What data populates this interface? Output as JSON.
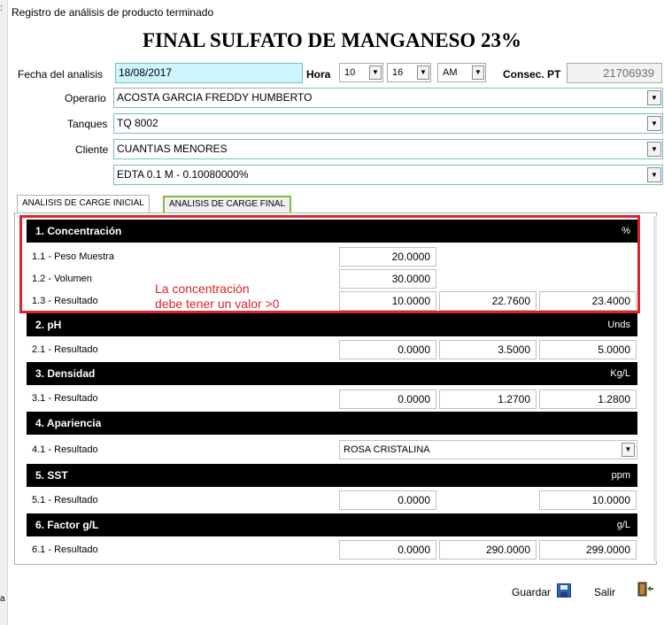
{
  "window": {
    "title": "Registro de análisis de producto terminado"
  },
  "heading": "FINAL SULFATO DE MANGANESO 23%",
  "form": {
    "fecha_label": "Fecha del analisis",
    "fecha_value": "18/08/2017",
    "hora_label": "Hora",
    "hora_h": "10",
    "hora_m": "16",
    "hora_ampm": "AM",
    "consec_label": "Consec. PT",
    "consec_value": "21706939",
    "operario_label": "Operario",
    "operario_value": "ACOSTA GARCIA FREDDY HUMBERTO",
    "tanques_label": "Tanques",
    "tanques_value": "TQ 8002",
    "cliente_label": "Cliente",
    "cliente_value": "CUANTIAS MENORES",
    "reactivo_value": "EDTA 0.1 M - 0.10080000%"
  },
  "tabs": [
    "ANALISIS DE CARGE INICIAL",
    "ANALISIS DE CARGE FINAL"
  ],
  "sections": {
    "s1": {
      "title": "1. Concentración",
      "unit": "%"
    },
    "s2": {
      "title": "2. pH",
      "unit": "Unds"
    },
    "s3": {
      "title": "3. Densidad",
      "unit": "Kg/L"
    },
    "s4": {
      "title": "4. Apariencia",
      "unit": ""
    },
    "s5": {
      "title": "5. SST",
      "unit": "ppm"
    },
    "s6": {
      "title": "6. Factor g/L",
      "unit": "g/L"
    }
  },
  "rows": {
    "r11": {
      "label": "1.1 - Peso Muestra",
      "v1": "20.0000"
    },
    "r12": {
      "label": "1.2 - Volumen",
      "v1": "30.0000"
    },
    "r13": {
      "label": "1.3 - Resultado",
      "v1": "10.0000",
      "v2": "22.7600",
      "v3": "23.4000"
    },
    "r21": {
      "label": "2.1 - Resultado",
      "v1": "0.0000",
      "v2": "3.5000",
      "v3": "5.0000"
    },
    "r31": {
      "label": "3.1 - Resultado",
      "v1": "0.0000",
      "v2": "1.2700",
      "v3": "1.2800"
    },
    "r41": {
      "label": "4.1 - Resultado",
      "value": "ROSA CRISTALINA"
    },
    "r51": {
      "label": "5.1 - Resultado",
      "v1": "0.0000",
      "v3": "10.0000"
    },
    "r61": {
      "label": "6.1 - Resultado",
      "v1": "0.0000",
      "v2": "290.0000",
      "v3": "299.0000"
    }
  },
  "annotation": {
    "line1": "La concentración",
    "line2": "debe tener un valor >0"
  },
  "actions": {
    "guardar": "Guardar",
    "salir": "Salir"
  },
  "icons": {
    "save": "save-icon",
    "exit": "exit-door-icon",
    "dropdown": "chevron-down-icon"
  },
  "colors": {
    "accent_border": "#7eb9c7",
    "annotation_red": "#d9252b",
    "date_bg": "#ccf5ff"
  }
}
